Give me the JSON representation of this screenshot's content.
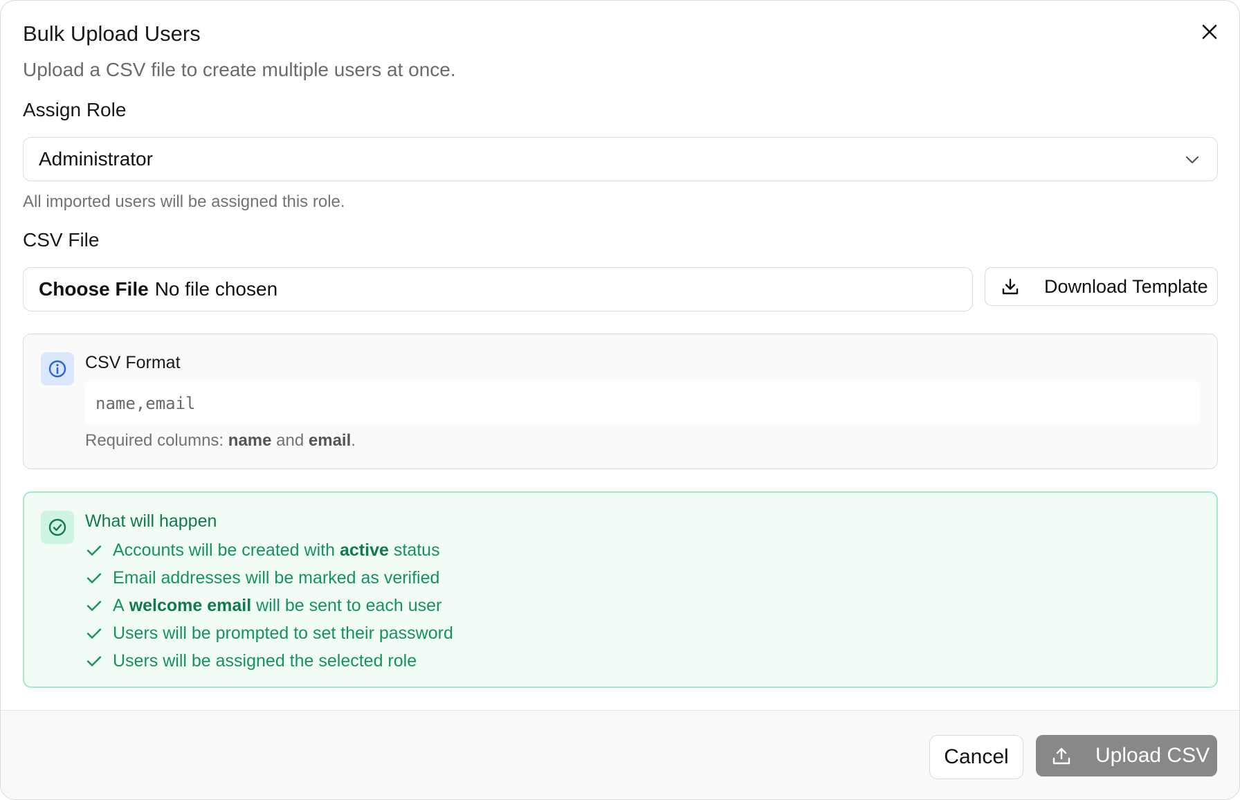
{
  "dialog": {
    "title": "Bulk Upload Users",
    "subtitle": "Upload a CSV file to create multiple users at once.",
    "close_icon": "close-icon"
  },
  "role": {
    "label": "Assign Role",
    "selected": "Administrator",
    "hint": "All imported users will be assigned this role."
  },
  "csv": {
    "label": "CSV File",
    "choose_label": "Choose File",
    "file_status": "No file chosen",
    "download_label": "Download Template"
  },
  "format": {
    "title": "CSV Format",
    "code": "name,email",
    "required_prefix": "Required columns:",
    "required_col1": "name",
    "required_and": "and",
    "required_col2": "email",
    "required_suffix": "."
  },
  "happen": {
    "title": "What will happen",
    "items": [
      {
        "before": "Accounts will be created with",
        "bold": "active",
        "after": "status"
      },
      {
        "before": "Email addresses will be marked as verified",
        "bold": "",
        "after": ""
      },
      {
        "before": "A",
        "bold": "welcome email",
        "after": "will be sent to each user"
      },
      {
        "before": "Users will be prompted to set their password",
        "bold": "",
        "after": ""
      },
      {
        "before": "Users will be assigned the selected role",
        "bold": "",
        "after": ""
      }
    ]
  },
  "footer": {
    "cancel_label": "Cancel",
    "upload_label": "Upload CSV"
  },
  "colors": {
    "accent_green": "#16925f",
    "info_blue": "#2563eb",
    "upload_disabled": "#888888"
  }
}
